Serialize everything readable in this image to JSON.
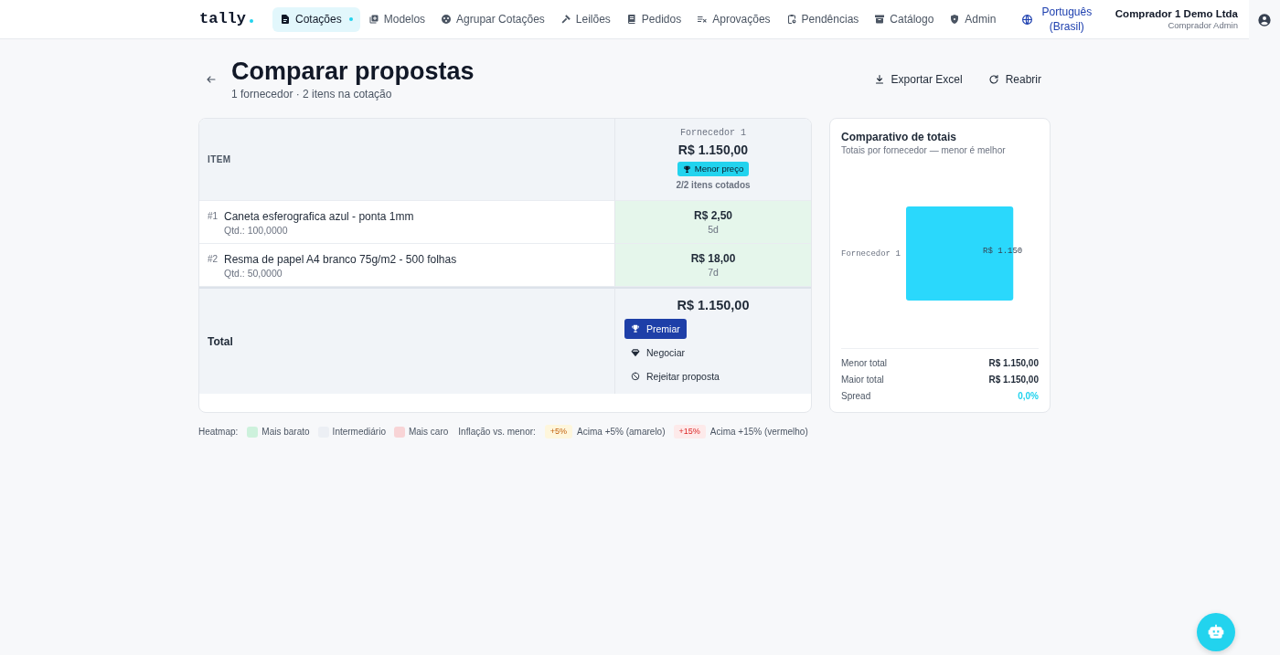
{
  "nav": {
    "logo": "tally",
    "items": [
      {
        "label": "Cotações",
        "selected": true,
        "dot": true
      },
      {
        "label": "Modelos",
        "selected": false,
        "dot": false
      },
      {
        "label": "Agrupar Cotações",
        "selected": false,
        "dot": false
      },
      {
        "label": "Leilões",
        "selected": false,
        "dot": false
      },
      {
        "label": "Pedidos",
        "selected": false,
        "dot": false
      },
      {
        "label": "Aprovações",
        "selected": false,
        "dot": false
      },
      {
        "label": "Pendências",
        "selected": false,
        "dot": false
      },
      {
        "label": "Catálogo",
        "selected": false,
        "dot": false
      },
      {
        "label": "Admin",
        "selected": false,
        "dot": false
      }
    ],
    "language": "Português (Brasil)",
    "user": {
      "name": "Comprador 1 Demo Ltda",
      "role": "Comprador Admin"
    }
  },
  "header": {
    "title": "Comparar propostas",
    "subtitle": "1 fornecedor · 2 itens na cotação",
    "actions": [
      {
        "label": "Exportar Excel",
        "kind": "export"
      },
      {
        "label": "Reabrir",
        "kind": "reopen"
      }
    ]
  },
  "table": {
    "item_header": "ITEM",
    "suppliers": [
      {
        "name": "Fornecedor 1",
        "total": "R$ 1.150,00",
        "badge": "Menor preço",
        "coverage": "2/2 itens cotados"
      }
    ],
    "rows": [
      {
        "number": "#1",
        "name": "Caneta esferografica azul - ponta 1mm",
        "quantity": "Qtd.: 100,0000",
        "cells": [
          {
            "price": "R$ 2,50",
            "lead_time": "5d",
            "color": "#e5f6eb"
          }
        ]
      },
      {
        "number": "#2",
        "name": "Resma de papel A4 branco 75g/m2 - 500 folhas",
        "quantity": "Qtd.: 50,0000",
        "cells": [
          {
            "price": "R$ 18,00",
            "lead_time": "7d",
            "color": "#e5f6eb"
          }
        ]
      }
    ],
    "total": {
      "label": "Total",
      "cells": [
        {
          "amount": "R$ 1.150,00",
          "actions": [
            {
              "label": "Premiar",
              "kind": "award"
            },
            {
              "label": "Negociar",
              "kind": "negotiate"
            },
            {
              "label": "Rejeitar proposta",
              "kind": "reject"
            }
          ]
        }
      ]
    }
  },
  "legend": {
    "heatmap_label": "Heatmap:",
    "heatmap": [
      {
        "label": "Mais barato",
        "color": "#cdf1dc"
      },
      {
        "label": "Intermediário",
        "color": "#eceff4"
      },
      {
        "label": "Mais caro",
        "color": "#f8d4d6"
      }
    ],
    "inflation_label": "Inflação vs. menor:",
    "inflation": [
      {
        "badge": "+5%",
        "label": "Acima +5% (amarelo)",
        "kind": "warning"
      },
      {
        "badge": "+15%",
        "label": "Acima +15% (vermelho)",
        "kind": "danger"
      }
    ]
  },
  "totals_panel": {
    "title": "Comparativo de totais",
    "subtitle": "Totais por fornecedor — menor é melhor",
    "bars": [
      {
        "category": "Fornecedor 1",
        "label": "R$ 1.150"
      }
    ],
    "stats": [
      {
        "label": "Menor total",
        "value": "R$ 1.150,00",
        "kind": "amount"
      },
      {
        "label": "Maior total",
        "value": "R$ 1.150,00",
        "kind": "amount"
      },
      {
        "label": "Spread",
        "value": "0,0%",
        "kind": "percent"
      }
    ]
  }
}
